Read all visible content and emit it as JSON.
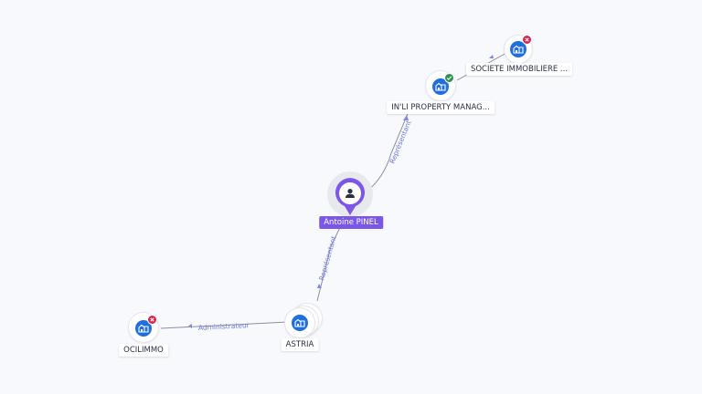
{
  "graph": {
    "center": {
      "name": "Antoine PINEL",
      "icon": "user-icon",
      "color": "#7c56e6"
    },
    "nodes": [
      {
        "id": "inli",
        "name": "IN'LI PROPERTY MANAG...",
        "icon": "building-icon",
        "status": "active",
        "status_icon": "check-icon"
      },
      {
        "id": "societe",
        "name": "SOCIETE IMMOBILIERE ...",
        "icon": "building-icon",
        "status": "closed",
        "status_icon": "close-icon"
      },
      {
        "id": "astria",
        "name": "ASTRIA",
        "icon": "building-icon",
        "status": "none"
      },
      {
        "id": "ocilimmo",
        "name": "OCILIMMO",
        "icon": "building-icon",
        "status": "closed",
        "status_icon": "close-icon"
      }
    ],
    "edges": [
      {
        "from": "center",
        "to": "inli",
        "label": "Représentant"
      },
      {
        "from": "inli",
        "to": "societe",
        "label": ""
      },
      {
        "from": "center",
        "to": "astria",
        "label": "Représentant"
      },
      {
        "from": "astria",
        "to": "ocilimmo",
        "label": "Administrateur"
      }
    ],
    "colors": {
      "company": "#1f6fe0",
      "closed": "#d6264f",
      "active": "#2a9350",
      "edge": "#8a8ea3",
      "edge_label": "#6e7bd6"
    }
  }
}
